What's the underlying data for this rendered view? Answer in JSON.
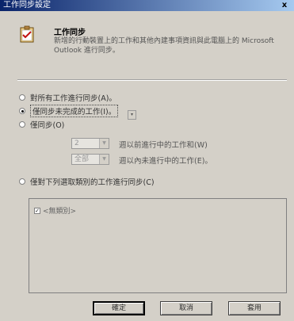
{
  "window": {
    "title": "工作同步設定",
    "close_label": "x"
  },
  "header": {
    "title": "工作同步",
    "description": "新增的行動裝置上的工作和其他內建事項資訊與此電腦上的 Microsoft Outlook 進行同步。"
  },
  "options": {
    "sync_all": "對所有工作進行同步(A)。",
    "sync_incomplete": "僅同步未完成的工作(I)。",
    "sync_range": "僅同步(O)",
    "range_value_1": "2",
    "range_label_1": "週以前進行中的工作和(W)",
    "range_value_2": "全部",
    "range_label_2": "週以內未進行中的工作(E)。",
    "sync_category": "僅對下列選取類別的工作進行同步(C)"
  },
  "category_list": {
    "items": [
      {
        "label": "<無類別>",
        "checked": true
      }
    ]
  },
  "buttons": {
    "ok": "確定",
    "cancel": "取消",
    "apply": "套用"
  }
}
